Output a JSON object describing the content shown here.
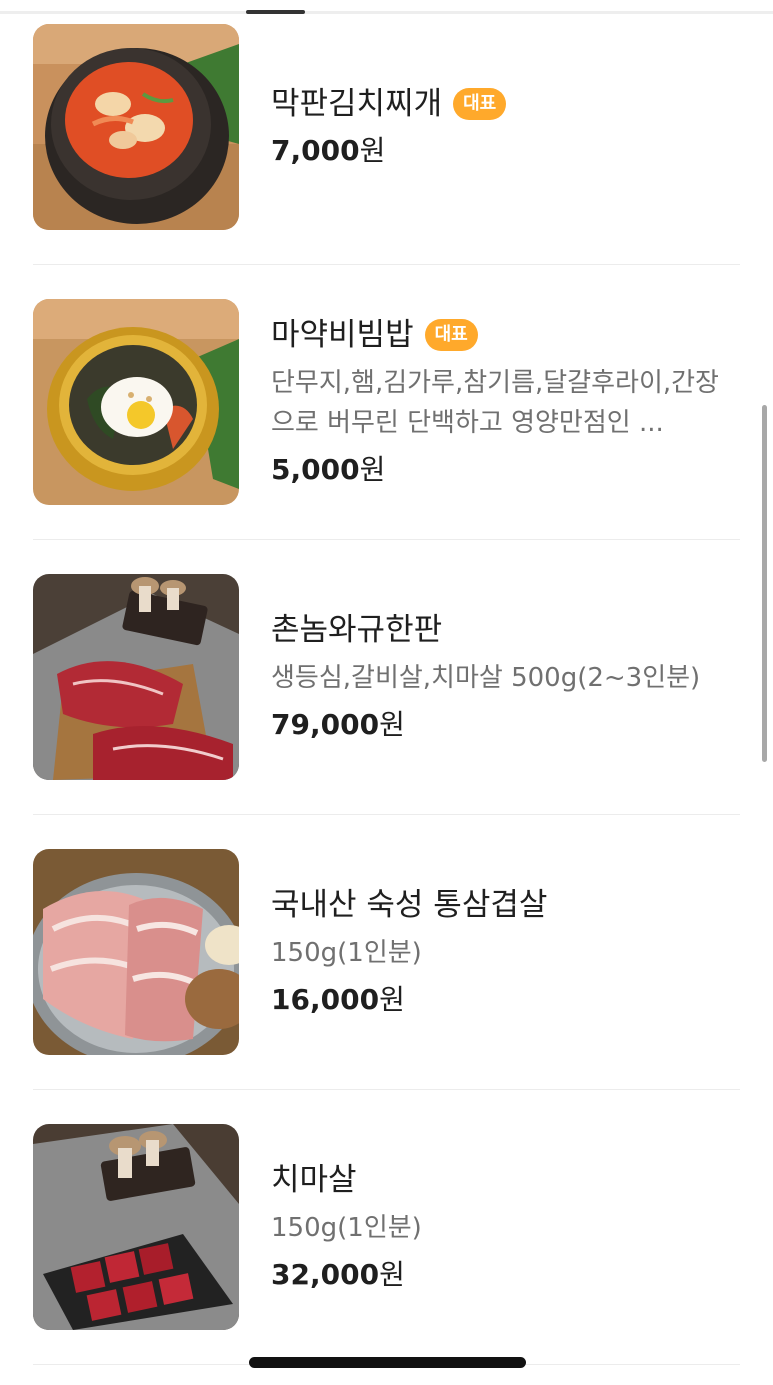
{
  "menu": {
    "items": [
      {
        "name": "막판김치찌개",
        "badge": "대표",
        "description": "",
        "price": "7,000",
        "currency": "원",
        "image_icon": "kimchi-stew-photo"
      },
      {
        "name": "마약비빔밥",
        "badge": "대표",
        "description": "단무지,햄,김가루,참기름,달걀후라이,간장으로 버무린 단백하고 영양만점인 ...",
        "price": "5,000",
        "currency": "원",
        "image_icon": "bibimbap-photo"
      },
      {
        "name": "촌놈와규한판",
        "badge": "",
        "description": "생등심,갈비살,치마살 500g(2~3인분)",
        "price": "79,000",
        "currency": "원",
        "image_icon": "wagyu-platter-photo"
      },
      {
        "name": "국내산 숙성 통삼겹살",
        "badge": "",
        "description": "150g(1인분)",
        "price": "16,000",
        "currency": "원",
        "image_icon": "pork-belly-photo"
      },
      {
        "name": "치마살",
        "badge": "",
        "description": "150g(1인분)",
        "price": "32,000",
        "currency": "원",
        "image_icon": "beef-skirt-photo"
      }
    ]
  },
  "colors": {
    "badge_background": "#ffa92b",
    "price_text": "#1f1f1f",
    "description_text": "#707070",
    "divider": "#ececec"
  }
}
